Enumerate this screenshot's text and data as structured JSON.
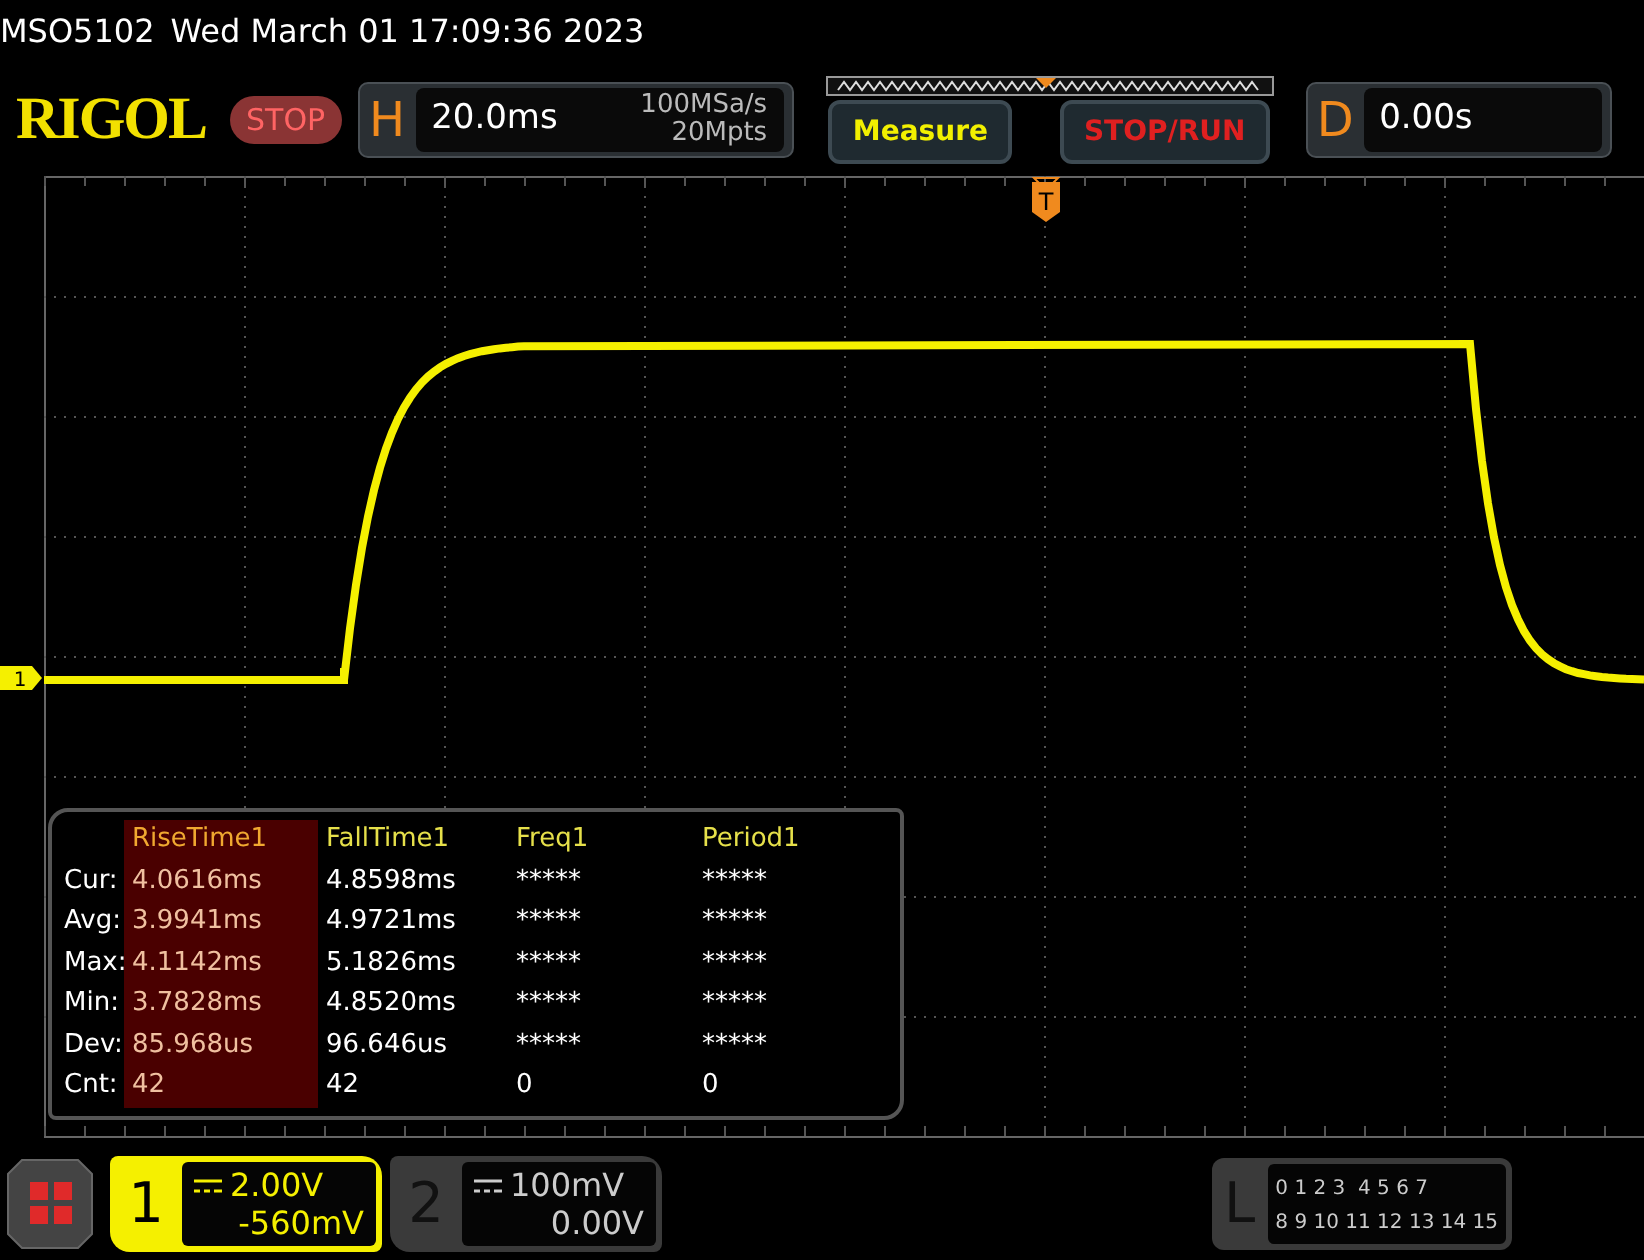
{
  "header": {
    "model": "MSO5102",
    "datetime": "Wed March 01 17:09:36 2023"
  },
  "toolbar": {
    "logo": "RIGOL",
    "run_state": "STOP",
    "horizontal": {
      "label": "H",
      "timebase": "20.0ms",
      "sample_rate": "100MSa/s",
      "memory_depth": "20Mpts"
    },
    "buttons": [
      {
        "label": "Measure",
        "kind": "measure"
      },
      {
        "label": "STOP/RUN",
        "kind": "run"
      }
    ],
    "delay": {
      "label": "D",
      "value": "0.00s"
    }
  },
  "screen": {
    "trigger_marker": "T",
    "channel_marker": "1"
  },
  "measurements": {
    "columns": [
      {
        "label": "RiseTime1",
        "selected": true
      },
      {
        "label": "FallTime1",
        "selected": false
      },
      {
        "label": "Freq1",
        "selected": false
      },
      {
        "label": "Period1",
        "selected": false
      }
    ],
    "rows": [
      {
        "label": "Cur:",
        "values": [
          "4.0616ms",
          "4.8598ms",
          "*****",
          "*****"
        ]
      },
      {
        "label": "Avg:",
        "values": [
          "3.9941ms",
          "4.9721ms",
          "*****",
          "*****"
        ]
      },
      {
        "label": "Max:",
        "values": [
          "4.1142ms",
          "5.1826ms",
          "*****",
          "*****"
        ]
      },
      {
        "label": "Min:",
        "values": [
          "3.7828ms",
          "4.8520ms",
          "*****",
          "*****"
        ]
      },
      {
        "label": "Dev:",
        "values": [
          "85.968us",
          "96.646us",
          "*****",
          "*****"
        ]
      },
      {
        "label": "Cnt:",
        "values": [
          "42",
          "42",
          "0",
          "0"
        ]
      }
    ]
  },
  "channels": [
    {
      "number": "1",
      "scale": "2.00V",
      "offset": "-560mV",
      "active": true
    },
    {
      "number": "2",
      "scale": "100mV",
      "offset": "0.00V",
      "active": false
    }
  ],
  "logic": {
    "label": "L",
    "rows": [
      "0 1 2 3  4 5 6 7",
      "8 9 10 11 12 13 14 15"
    ]
  }
}
